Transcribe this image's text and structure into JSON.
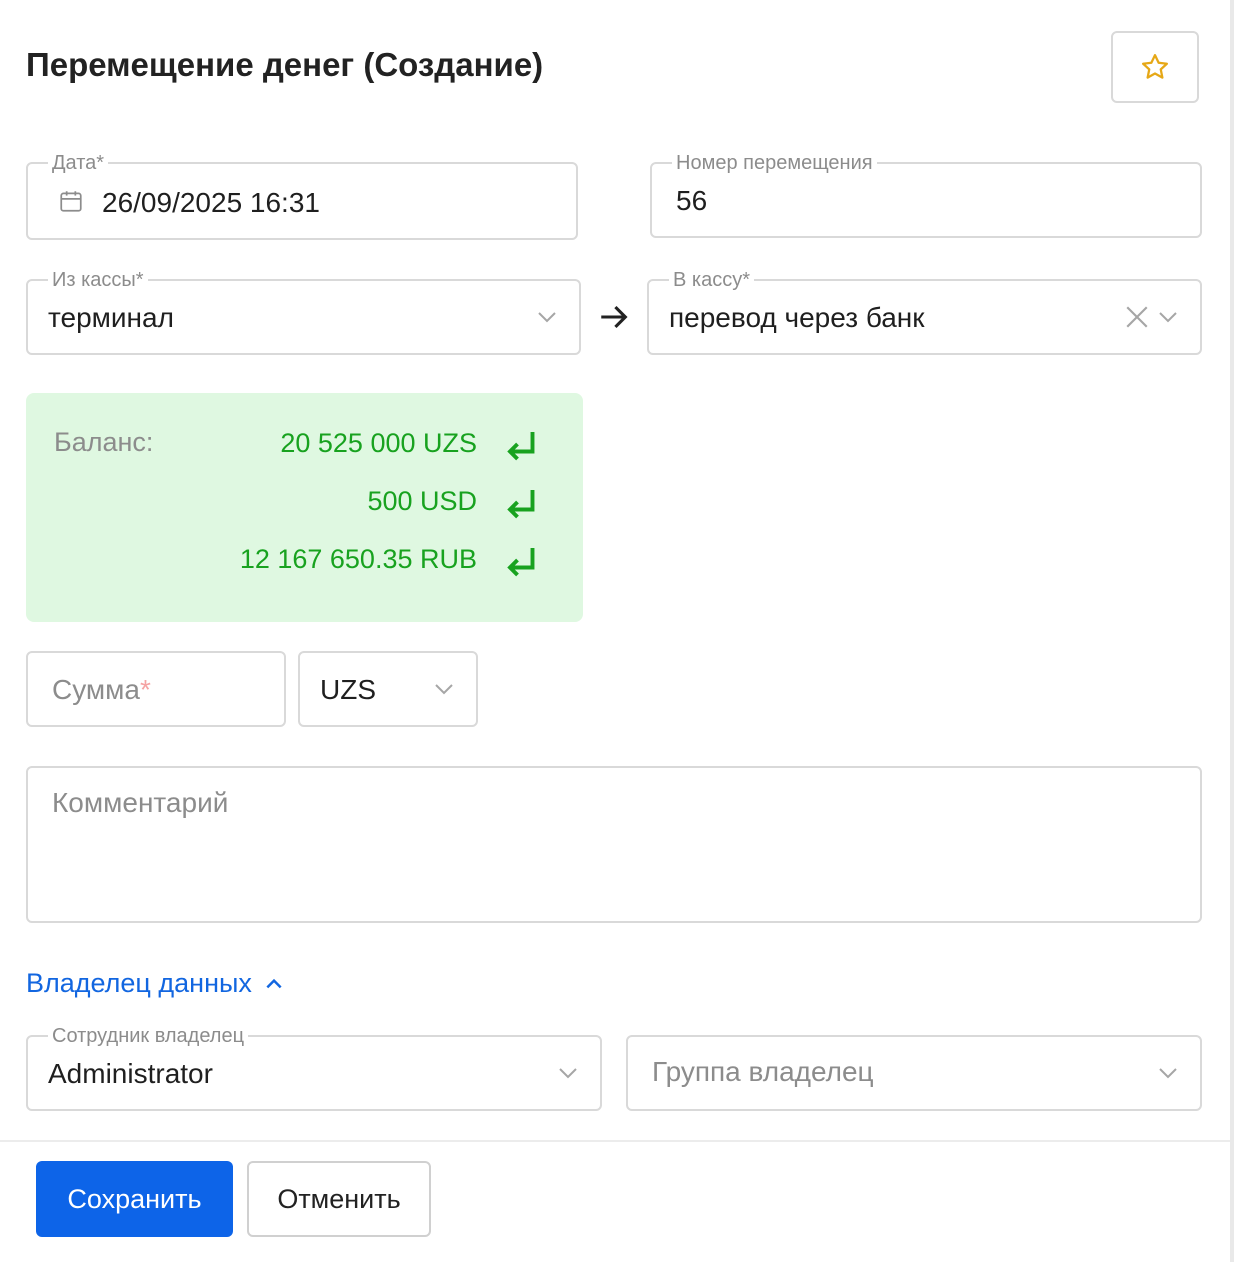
{
  "header": {
    "title": "Перемещение денег (Создание)",
    "star_icon": "star-icon"
  },
  "form": {
    "date": {
      "label": "Дата*",
      "value": "26/09/2025 16:31"
    },
    "number": {
      "label": "Номер перемещения",
      "value": "56"
    },
    "from_cash": {
      "label": "Из кассы*",
      "value": "терминал"
    },
    "to_cash": {
      "label": "В кассу*",
      "value": "перевод через банк"
    },
    "balance": {
      "label": "Баланс:",
      "rows": [
        "20 525 000 UZS",
        "500 USD",
        "12 167 650.35 RUB"
      ]
    },
    "amount": {
      "placeholder": "Сумма",
      "required_mark": "*"
    },
    "currency": {
      "value": "UZS"
    },
    "comment": {
      "placeholder": "Комментарий"
    }
  },
  "owner": {
    "toggle_label": "Владелец данных",
    "employee": {
      "label": "Сотрудник владелец",
      "value": "Administrator"
    },
    "group": {
      "placeholder": "Группа владелец"
    }
  },
  "footer": {
    "save_label": "Сохранить",
    "cancel_label": "Отменить"
  },
  "colors": {
    "accent": "#0d64e8",
    "balance_bg": "#dff8e1",
    "balance_text": "#18a21f",
    "star": "#e6a817"
  }
}
